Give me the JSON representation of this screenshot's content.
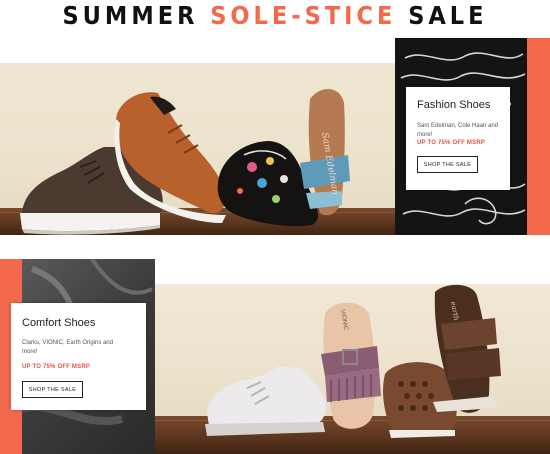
{
  "headline": {
    "part1": "SUMMER ",
    "part2": "SOLE-STICE",
    "part3": " SALE",
    "color_dark": "#111111",
    "color_accent": "#f26a4b"
  },
  "promos": [
    {
      "title": "Fashion Shoes",
      "brands": "Sam Edelman, Cole Haan and more!",
      "offer": "UP TO 75% OFF MSRP",
      "button": "SHOP THE SALE"
    },
    {
      "title": "Comfort Shoes",
      "brands": "Clarks, VIONIC, Earth Origins and more!",
      "offer": "UP TO 75% OFF MSRP",
      "button": "SHOP THE SALE"
    }
  ],
  "brand_marks": {
    "sam_edelman": "Sam Edelman",
    "vionic": "VIONIC",
    "earth": "earth"
  },
  "colors": {
    "accent": "#f26a4b",
    "offer_red": "#e4524a",
    "wood": "#5d3620"
  }
}
